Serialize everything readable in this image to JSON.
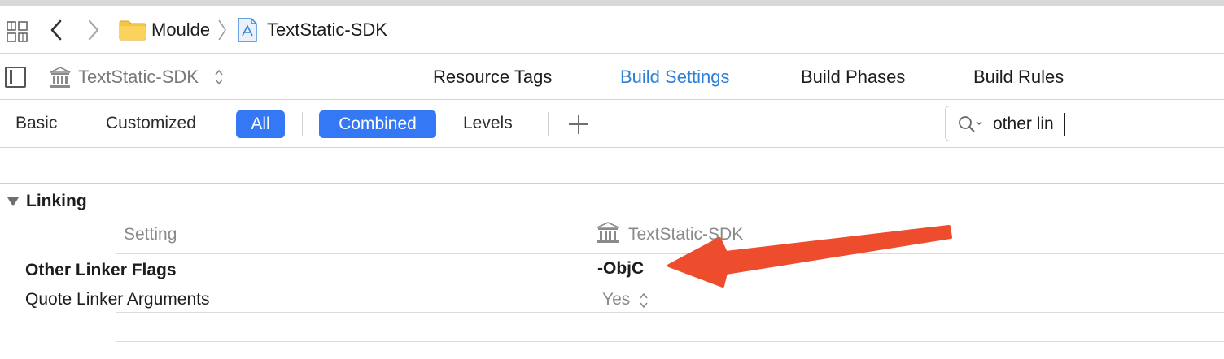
{
  "breadcrumb": {
    "folder": "Moulde",
    "project": "TextStatic-SDK"
  },
  "icons": {
    "grid": "grid-icon",
    "back": "chevron-left-icon",
    "forward": "chevron-right-icon",
    "folder": "folder-icon",
    "project": "xcode-project-icon",
    "target": "target-building-icon",
    "search": "search-icon"
  },
  "target_selector": {
    "label": "TextStatic-SDK"
  },
  "tabs": [
    {
      "label": "Resource Tags",
      "active": false
    },
    {
      "label": "Build Settings",
      "active": true
    },
    {
      "label": "Build Phases",
      "active": false
    },
    {
      "label": "Build Rules",
      "active": false
    }
  ],
  "filters": {
    "basic": "Basic",
    "customized": "Customized",
    "all": "All",
    "combined": "Combined",
    "levels": "Levels"
  },
  "search": {
    "value": "other lin"
  },
  "section": {
    "title": "Linking",
    "col_setting": "Setting",
    "col_target": "TextStatic-SDK",
    "rows": [
      {
        "label": "Other Linker Flags",
        "value": "-ObjC",
        "bold": true
      },
      {
        "label": "Quote Linker Arguments",
        "value": "Yes",
        "bold": false
      }
    ]
  },
  "colors": {
    "accent": "#3478f6",
    "tab_active": "#2f7fd6",
    "annotation_arrow": "#ee4d2d"
  }
}
